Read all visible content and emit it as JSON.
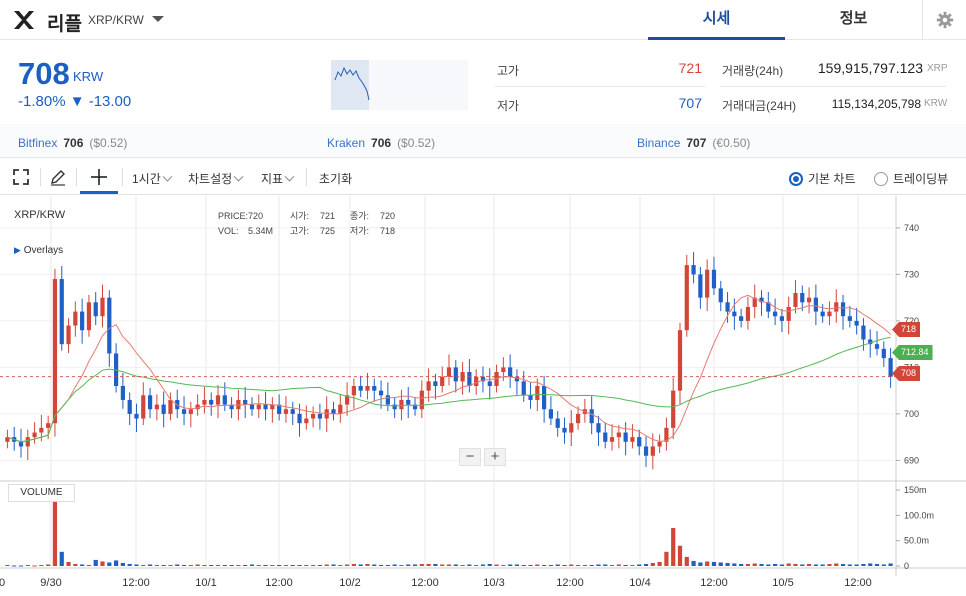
{
  "header": {
    "coin_name": "리플",
    "pair": "XRP/KRW",
    "tabs": [
      {
        "label": "시세",
        "active": true
      },
      {
        "label": "정보",
        "active": false
      }
    ]
  },
  "price": {
    "current": "708",
    "unit": "KRW",
    "change_text": "-1.80% ▼ -13.00"
  },
  "stats": {
    "high_label": "고가",
    "high_value": "721",
    "low_label": "저가",
    "low_value": "707",
    "volume_label": "거래량(24h)",
    "volume_value": "159,915,797.123",
    "volume_unit": "XRP",
    "amount_label": "거래대금(24H)",
    "amount_value": "115,134,205,798",
    "amount_unit": "KRW"
  },
  "exchanges": [
    {
      "name": "Bitfinex",
      "price": "706",
      "foreign": "($0.52)"
    },
    {
      "name": "Kraken",
      "price": "706",
      "foreign": "($0.52)"
    },
    {
      "name": "Binance",
      "price": "707",
      "foreign": "(€0.50)"
    }
  ],
  "toolbar": {
    "interval": "1시간",
    "chart_settings": "차트설정",
    "indicators": "지표",
    "reset": "초기화",
    "radio_basic": "기본 차트",
    "radio_tradingview": "트레이딩뷰"
  },
  "chart": {
    "symbol": "XRP/KRW",
    "ohlc_labels": {
      "price": "PRICE:",
      "vol": "VOL:",
      "open": "시가:",
      "high": "고가:",
      "close": "종가:",
      "low": "저가:"
    },
    "ohlc_values": {
      "price": "720",
      "vol": "5.34M",
      "open": "721",
      "high": "725",
      "close": "720",
      "low": "718"
    },
    "overlays_label": "Overlays",
    "volume_label": "VOLUME",
    "zoom_out": "−",
    "zoom_in": "+",
    "price_ticks": [
      "740",
      "730",
      "720",
      "710",
      "700",
      "690"
    ],
    "volume_ticks": [
      "150m",
      "100.0m",
      "50.0m",
      "0"
    ],
    "x_ticks": [
      "0",
      "9/30",
      "12:00",
      "10/1",
      "12:00",
      "10/2",
      "12:00",
      "10/3",
      "12:00",
      "10/4",
      "12:00",
      "10/5",
      "12:00"
    ],
    "price_tags": [
      "718",
      "712.84",
      "708"
    ],
    "up_color": "#d2463a",
    "down_color": "#1f5fc8",
    "ma_short_color": "#e47b6f",
    "ma_long_color": "#55b854"
  },
  "chart_data": {
    "type": "candlestick",
    "x": "hourly, 9/29 ~ 10/5",
    "close_series": [
      695,
      694,
      693,
      695,
      696,
      697,
      698,
      729,
      715,
      719,
      722,
      718,
      724,
      721,
      725,
      713,
      706,
      703,
      700,
      699,
      704,
      701,
      702,
      700,
      703,
      701,
      700,
      701,
      702,
      703,
      702,
      704,
      702,
      701,
      703,
      702,
      701,
      702,
      701,
      702,
      700,
      701,
      700,
      698,
      699,
      700,
      699,
      701,
      700,
      702,
      704,
      706,
      705,
      706,
      705,
      704,
      702,
      701,
      703,
      702,
      701,
      705,
      707,
      706,
      708,
      710,
      707,
      709,
      706,
      708,
      707,
      706,
      709,
      710,
      708,
      707,
      704,
      703,
      706,
      701,
      699,
      697,
      696,
      698,
      700,
      701,
      698,
      696,
      694,
      695,
      696,
      694,
      695,
      693,
      691,
      693,
      694,
      697,
      705,
      718,
      732,
      730,
      725,
      731,
      727,
      724,
      722,
      721,
      720,
      723,
      725,
      724,
      722,
      721,
      720,
      723,
      726,
      724,
      725,
      722,
      721,
      722,
      724,
      721,
      720,
      719,
      716,
      715,
      714,
      712,
      708
    ],
    "volume_series_m": [
      2,
      1,
      1,
      2,
      1,
      2,
      3,
      150,
      28,
      8,
      4,
      3,
      2,
      12,
      9,
      7,
      11,
      6,
      4,
      3,
      2,
      3,
      2,
      2,
      2,
      3,
      2,
      2,
      3,
      2,
      2,
      2,
      2,
      2,
      2,
      2,
      3,
      2,
      2,
      2,
      2,
      2,
      2,
      2,
      2,
      2,
      2,
      3,
      3,
      2,
      3,
      4,
      3,
      4,
      3,
      2,
      2,
      3,
      2,
      3,
      3,
      4,
      4,
      4,
      3,
      3,
      3,
      2,
      3,
      2,
      3,
      4,
      3,
      2,
      3,
      3,
      2,
      2,
      3,
      2,
      2,
      3,
      2,
      3,
      2,
      2,
      2,
      3,
      3,
      2,
      3,
      2,
      2,
      3,
      4,
      6,
      8,
      28,
      75,
      40,
      18,
      10,
      7,
      9,
      8,
      7,
      6,
      5,
      4,
      4,
      5,
      4,
      3,
      4,
      3,
      5,
      4,
      3,
      4,
      3,
      3,
      4,
      5,
      4,
      3,
      3,
      4,
      5,
      4,
      3,
      5
    ],
    "ylim": [
      686,
      746
    ],
    "volume_ylim": [
      0,
      160
    ]
  }
}
